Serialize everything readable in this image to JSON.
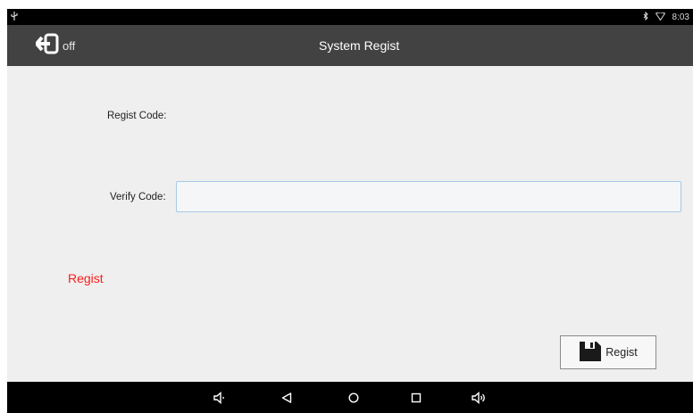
{
  "status_bar": {
    "time": "8:03",
    "icons": [
      "usb-icon",
      "bluetooth-icon",
      "wifi-icon"
    ]
  },
  "app_bar": {
    "back_label": "off",
    "title": "System Regist"
  },
  "form": {
    "regist_code_label": "Regist Code:",
    "regist_code_value": "",
    "verify_code_label": "Verify Code:",
    "verify_code_value": ""
  },
  "status_message": "Regist",
  "regist_button": {
    "label": "Regist",
    "icon": "save-icon"
  },
  "nav_bar": {
    "buttons": [
      "volume-down-icon",
      "back-icon",
      "home-icon",
      "recents-icon",
      "volume-up-icon"
    ]
  },
  "colors": {
    "app_bar": "#424242",
    "content_bg": "#eeefee",
    "status_message": "#ff1c1c",
    "input_border": "#a9c9e6"
  }
}
